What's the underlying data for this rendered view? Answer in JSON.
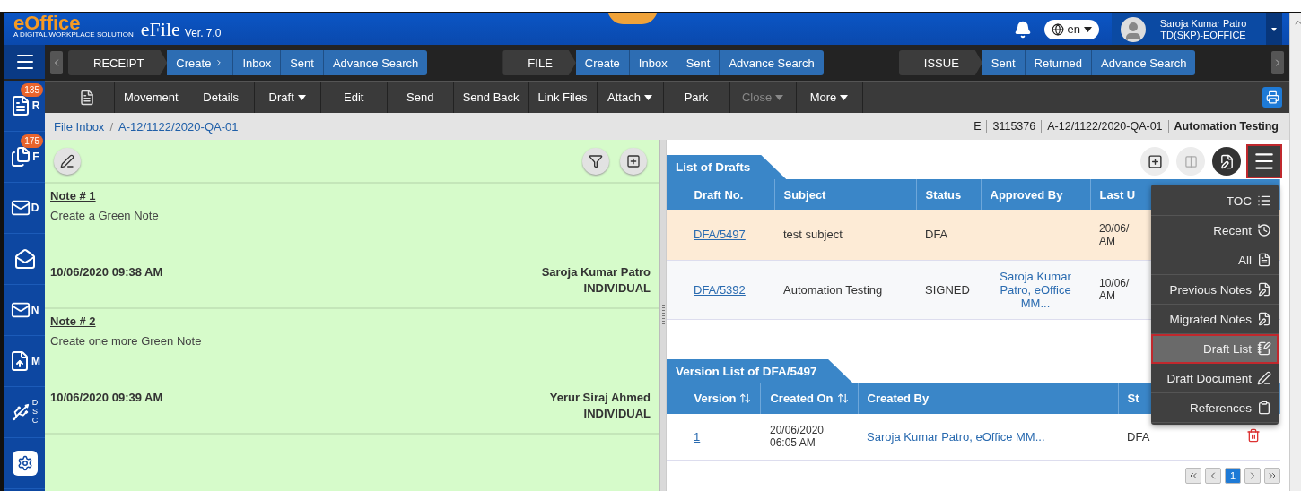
{
  "header": {
    "logo": "eOffice",
    "tagline": "A DIGITAL WORKPLACE SOLUTION",
    "app": "eFile",
    "version": "Ver. 7.0",
    "language": "en",
    "user_name": "Saroja Kumar Patro",
    "user_role": "TD(SKP)-EOFFICE"
  },
  "sidebar": [
    {
      "kind": "receipt",
      "letter": "R",
      "badge": "135"
    },
    {
      "kind": "file",
      "letter": "F",
      "badge": "175"
    },
    {
      "kind": "dispatch",
      "letter": "D"
    },
    {
      "kind": "inbox"
    },
    {
      "kind": "notice",
      "letter": "N"
    },
    {
      "kind": "migrate",
      "letter": "M"
    },
    {
      "kind": "dsc",
      "letter": "DSC"
    },
    {
      "kind": "settings"
    }
  ],
  "nav_groups": [
    {
      "title": "RECEIPT",
      "items": [
        {
          "label": "Create",
          "submenu": true
        },
        {
          "label": "Inbox",
          "submenu": false
        },
        {
          "label": "Sent",
          "submenu": false
        },
        {
          "label": "Advance Search",
          "submenu": false
        }
      ]
    },
    {
      "title": "FILE",
      "items": [
        {
          "label": "Create",
          "submenu": false
        },
        {
          "label": "Inbox",
          "submenu": false
        },
        {
          "label": "Sent",
          "submenu": false
        },
        {
          "label": "Advance Search",
          "submenu": false
        }
      ]
    },
    {
      "title": "ISSUE",
      "items": [
        {
          "label": "Sent",
          "submenu": false
        },
        {
          "label": "Returned",
          "submenu": false
        },
        {
          "label": "Advance Search",
          "submenu": false
        }
      ]
    }
  ],
  "toolbar": [
    {
      "label": "Movement",
      "dropdown": false,
      "disabled": false
    },
    {
      "label": "Details",
      "dropdown": false,
      "disabled": false
    },
    {
      "label": "Draft",
      "dropdown": true,
      "disabled": false
    },
    {
      "label": "Edit",
      "dropdown": false,
      "disabled": false
    },
    {
      "label": "Send",
      "dropdown": false,
      "disabled": false
    },
    {
      "label": "Send Back",
      "dropdown": false,
      "disabled": false
    },
    {
      "label": "Link Files",
      "dropdown": false,
      "disabled": false
    },
    {
      "label": "Attach",
      "dropdown": true,
      "disabled": false
    },
    {
      "label": "Park",
      "dropdown": false,
      "disabled": false
    },
    {
      "label": "Close",
      "dropdown": true,
      "disabled": true
    },
    {
      "label": "More",
      "dropdown": true,
      "disabled": false
    }
  ],
  "breadcrumb": {
    "separator": "/",
    "items": [
      "File Inbox",
      "A-12/1122/2020-QA-01"
    ]
  },
  "file_info": {
    "type": "E",
    "number": "3115376",
    "file_no": "A-12/1122/2020-QA-01",
    "subject": "Automation Testing"
  },
  "notes": [
    {
      "title": "Note # 1",
      "text": "Create a Green Note",
      "date": "10/06/2020 09:38 AM",
      "author": "Saroja Kumar Patro",
      "role": "INDIVIDUAL"
    },
    {
      "title": "Note # 2",
      "text": "Create one more Green Note",
      "date": "10/06/2020 09:39 AM",
      "author": "Yerur Siraj Ahmed",
      "role": "INDIVIDUAL"
    }
  ],
  "panel_tools": [
    {
      "kind": "add",
      "active": false
    },
    {
      "kind": "compare",
      "active": false
    },
    {
      "kind": "draft",
      "active": true
    },
    {
      "kind": "menu",
      "active": true
    }
  ],
  "drafts": {
    "title": "List of Drafts",
    "columns": [
      "Draft No.",
      "Subject",
      "Status",
      "Approved By",
      "Last U"
    ],
    "rows": [
      {
        "selected": true,
        "draft_no": "DFA/5497",
        "subject": "test subject",
        "status": "DFA",
        "last_updated": "20/06/ AM"
      },
      {
        "selected": false,
        "draft_no": "DFA/5392",
        "subject": "Automation Testing",
        "status": "SIGNED",
        "approved_by": "Saroja Kumar Patro, eOffice MM...",
        "last_updated": "10/06/ AM"
      }
    ]
  },
  "versions": {
    "title": "Version List of DFA/5497",
    "columns": [
      {
        "label": "Version",
        "sortable": true
      },
      {
        "label": "Created On",
        "sortable": true
      },
      {
        "label": "Created By",
        "sortable": false
      },
      {
        "label": "St",
        "sortable": false
      }
    ],
    "rows": [
      {
        "version": "1",
        "created_on": "20/06/2020 06:05 AM",
        "created_by": "Saroja Kumar Patro, eOffice MM...",
        "status": "DFA"
      }
    ],
    "pages": [
      {
        "label": "1",
        "selected": true
      }
    ]
  },
  "menu": [
    {
      "label": "TOC",
      "kind": "toc",
      "selected": false
    },
    {
      "label": "Recent",
      "kind": "recent",
      "selected": false
    },
    {
      "label": "All",
      "kind": "pdf",
      "selected": false
    },
    {
      "label": "Previous Notes",
      "kind": "note",
      "selected": false
    },
    {
      "label": "Migrated Notes",
      "kind": "note",
      "selected": false
    },
    {
      "label": "Draft List",
      "kind": "draft",
      "selected": true
    },
    {
      "label": "Draft Document",
      "kind": "document",
      "selected": false
    },
    {
      "label": "References",
      "kind": "clipboard",
      "selected": false
    }
  ]
}
